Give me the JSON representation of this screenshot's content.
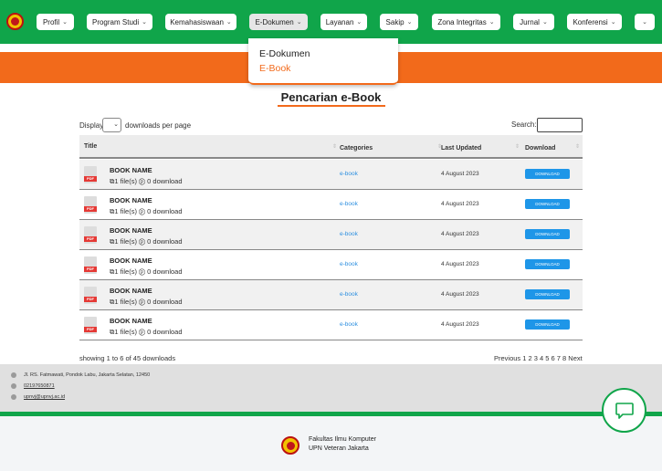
{
  "nav": {
    "items": [
      {
        "label": "Profil"
      },
      {
        "label": "Program Studi"
      },
      {
        "label": "Kemahasiswaan"
      },
      {
        "label": "E-Dokumen"
      },
      {
        "label": "Layanan"
      },
      {
        "label": "Sakip"
      },
      {
        "label": "Zona Integritas"
      },
      {
        "label": "Jurnal"
      },
      {
        "label": "Konferensi"
      }
    ],
    "active_index": 3
  },
  "dropdown": {
    "items": [
      {
        "label": "E-Dokumen"
      },
      {
        "label": "E-Book"
      }
    ]
  },
  "page": {
    "title": "Pencarian e-Book"
  },
  "controls": {
    "display_label": "Display",
    "per_page_label": "downloads per page",
    "search_label": "Search:"
  },
  "table": {
    "headers": {
      "title": "Title",
      "categories": "Categories",
      "last_updated": "Last Updated",
      "download": "Download"
    },
    "rows": [
      {
        "name": "BOOK NAME",
        "files": "1 file(s)",
        "downloads": "0 download",
        "category": "e-book",
        "date": "4 August 2023",
        "button": "DOWNLOAD",
        "icon_tag": "PDF"
      },
      {
        "name": "BOOK NAME",
        "files": "1 file(s)",
        "downloads": "0 download",
        "category": "e-book",
        "date": "4 August 2023",
        "button": "DOWNLOAD",
        "icon_tag": "PDF"
      },
      {
        "name": "BOOK NAME",
        "files": "1 file(s)",
        "downloads": "0 download",
        "category": "e-book",
        "date": "4 August 2023",
        "button": "DOWNLOAD",
        "icon_tag": "PDF"
      },
      {
        "name": "BOOK NAME",
        "files": "1 file(s)",
        "downloads": "0 download",
        "category": "e-book",
        "date": "4 August 2023",
        "button": "DOWNLOAD",
        "icon_tag": "PDF"
      },
      {
        "name": "BOOK NAME",
        "files": "1 file(s)",
        "downloads": "0 download",
        "category": "e-book",
        "date": "4 August 2023",
        "button": "DOWNLOAD",
        "icon_tag": "PDF"
      },
      {
        "name": "BOOK NAME",
        "files": "1 file(s)",
        "downloads": "0 download",
        "category": "e-book",
        "date": "4 August 2023",
        "button": "DOWNLOAD",
        "icon_tag": "PDF"
      }
    ]
  },
  "pagination": {
    "showing": "showing 1 to 6 of 45 downloads",
    "pager": "Previous 1 2 3 4 5 6 7 8 Next"
  },
  "footer": {
    "address": "Jl. RS. Fatmawati, Pondok Labu, Jakarta Selatan, 12450",
    "phone": "02197650871",
    "email": "upnvj@upnvj.ac.id",
    "org_line1": "Fakultas Ilmu Komputer",
    "org_line2": "UPN Veteran Jakarta"
  },
  "colors": {
    "brand_green": "#10a54a",
    "brand_orange": "#f26a1b",
    "download_blue": "#1e96e8",
    "category_blue": "#2c8fe0"
  }
}
